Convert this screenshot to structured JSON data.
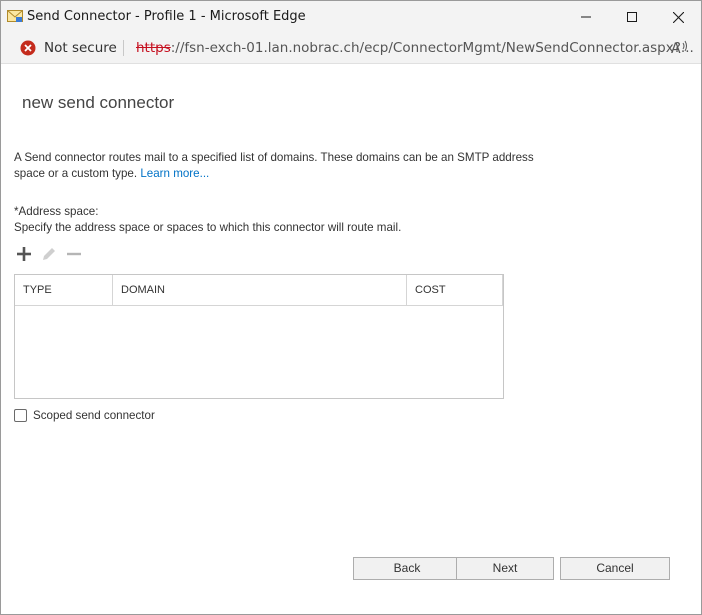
{
  "window": {
    "title": "Send Connector - Profile 1 - Microsoft Edge",
    "icons": {
      "app": "mail-envelope-icon",
      "minimize": "minimize-icon",
      "maximize": "maximize-icon",
      "close": "close-icon"
    }
  },
  "address_bar": {
    "security_icon": "error-circle-icon",
    "security_label": "Not secure",
    "url_scheme": "https",
    "url_rest": "://fsn-exch-01.lan.nobrac.ch/ecp/ConnectorMgmt/NewSendConnector.aspx?...",
    "reader_icon": "read-aloud-icon"
  },
  "page": {
    "heading": "new send connector",
    "description": "A Send connector routes mail to a specified list of domains. These domains can be an SMTP address space or a custom type.",
    "learn_more": "Learn more...",
    "address_space_label": "*Address space:",
    "address_space_help": "Specify the address space or spaces to which this connector will route mail.",
    "toolbar": {
      "add_icon": "plus-icon",
      "edit_icon": "pencil-icon",
      "remove_icon": "minus-icon"
    },
    "table": {
      "columns": [
        "TYPE",
        "DOMAIN",
        "COST"
      ],
      "rows": []
    },
    "scoped_label": "Scoped send connector",
    "scoped_checked": false
  },
  "buttons": {
    "back": "Back",
    "next": "Next",
    "cancel": "Cancel"
  },
  "colors": {
    "link": "#0072c6",
    "insecure": "#c50f1f",
    "error_icon": "#c42b1c"
  }
}
